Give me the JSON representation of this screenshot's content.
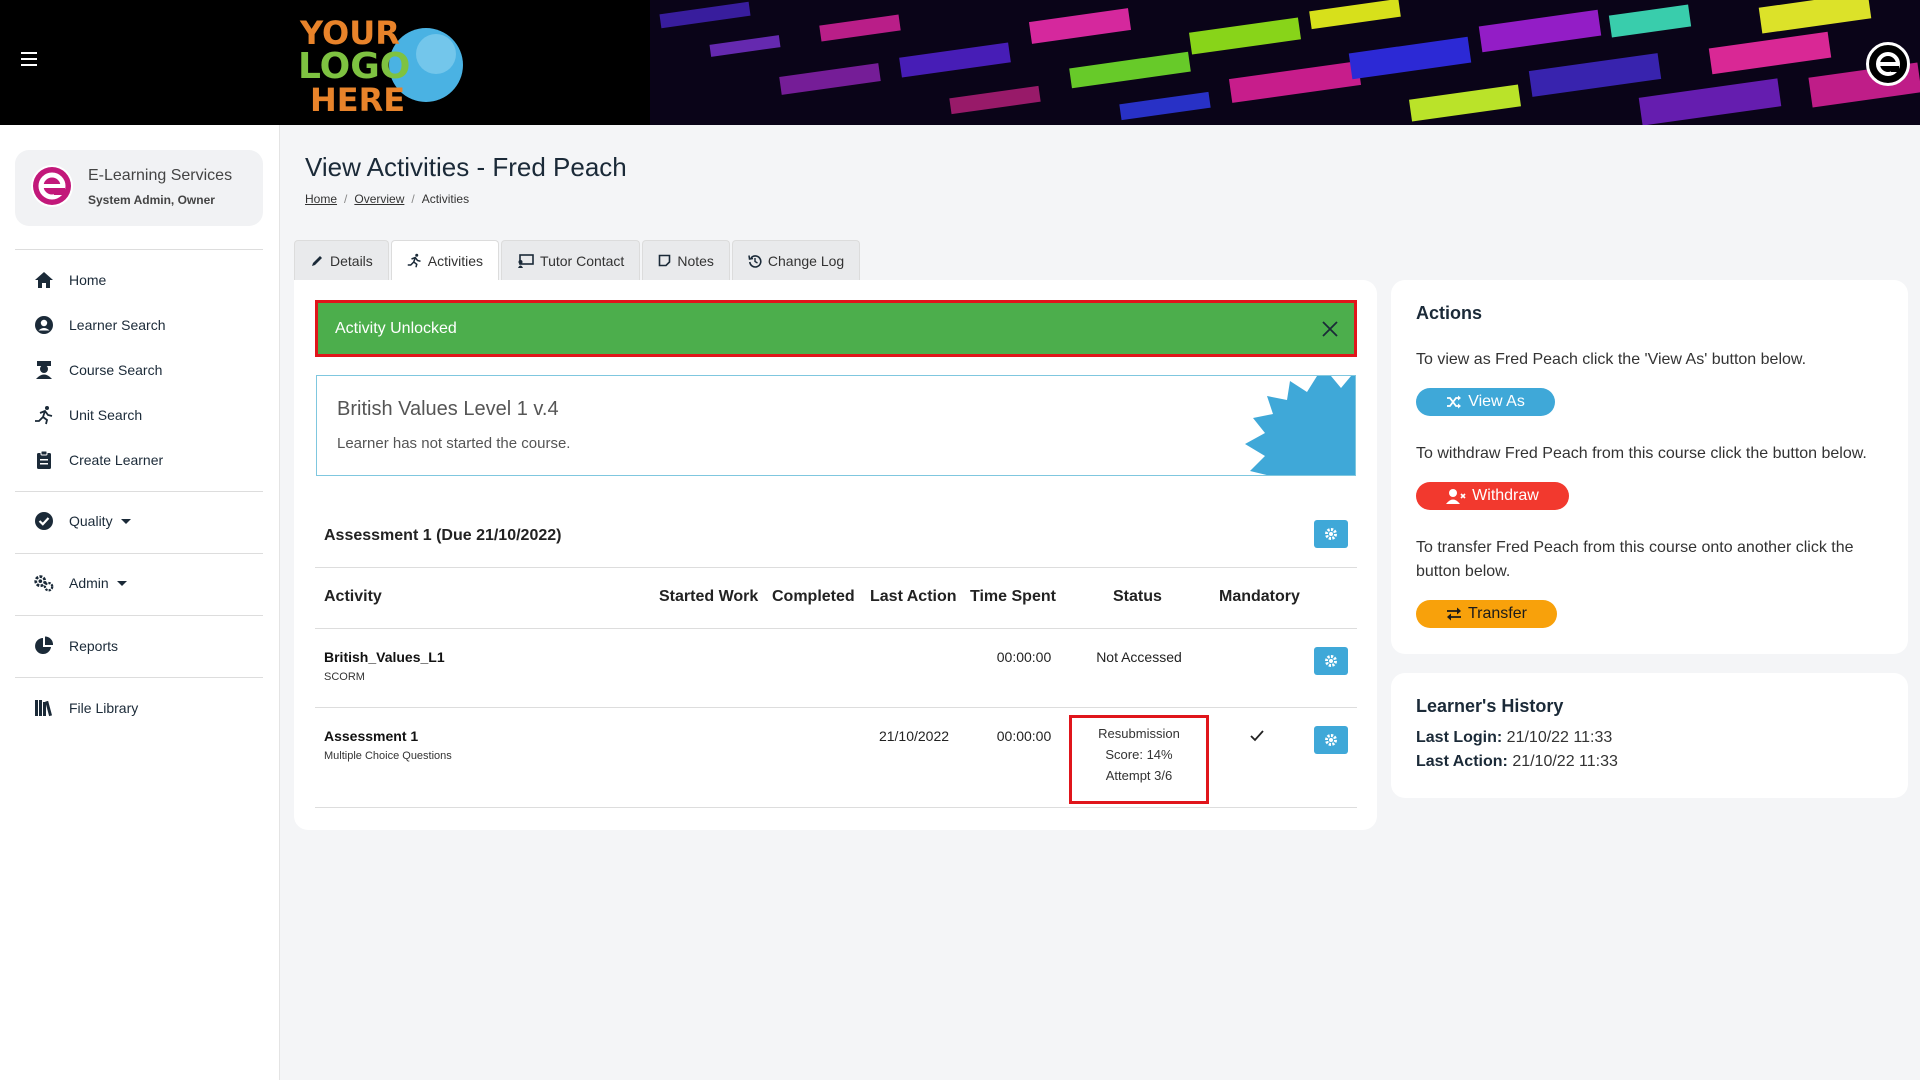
{
  "header": {
    "logo_text": [
      "YOUR",
      "LOGO",
      "HERE"
    ]
  },
  "sidebar": {
    "profile": {
      "name": "E-Learning Services",
      "role": "System Admin, Owner"
    },
    "items": [
      {
        "label": "Home",
        "icon": "home-icon"
      },
      {
        "label": "Learner Search",
        "icon": "user-circle-icon"
      },
      {
        "label": "Course Search",
        "icon": "graduate-icon"
      },
      {
        "label": "Unit Search",
        "icon": "runner-icon"
      },
      {
        "label": "Create Learner",
        "icon": "clipboard-icon"
      },
      {
        "label": "Quality",
        "icon": "check-circle-icon"
      },
      {
        "label": "Admin",
        "icon": "gears-icon"
      },
      {
        "label": "Reports",
        "icon": "pie-chart-icon"
      },
      {
        "label": "File Library",
        "icon": "books-icon"
      }
    ]
  },
  "page": {
    "title": "View Activities - Fred Peach",
    "breadcrumb": [
      "Home",
      "Overview",
      "Activities"
    ]
  },
  "tabs": [
    {
      "label": "Details",
      "icon": "pencil-icon"
    },
    {
      "label": "Activities",
      "icon": "runner-icon"
    },
    {
      "label": "Tutor Contact",
      "icon": "chalkboard-icon"
    },
    {
      "label": "Notes",
      "icon": "note-icon"
    },
    {
      "label": "Change Log",
      "icon": "history-icon"
    }
  ],
  "alert": {
    "text": "Activity Unlocked"
  },
  "course": {
    "title": "British Values Level 1 v.4",
    "status": "Learner has not started the course."
  },
  "assessment": {
    "heading": "Assessment 1 (Due 21/10/2022)",
    "columns": [
      "Activity",
      "Started Work",
      "Completed",
      "Last Action",
      "Time Spent",
      "Status",
      "Mandatory"
    ],
    "rows": [
      {
        "title": "British_Values_L1",
        "subtitle": "SCORM",
        "started": "",
        "completed": "",
        "last_action": "",
        "time_spent": "00:00:00",
        "status": [
          "Not Accessed"
        ],
        "mandatory": false
      },
      {
        "title": "Assessment 1",
        "subtitle": "Multiple Choice Questions",
        "started": "",
        "completed": "",
        "last_action": "21/10/2022",
        "time_spent": "00:00:00",
        "status": [
          "Resubmission",
          "Score: 14%",
          "Attempt 3/6"
        ],
        "mandatory": true
      }
    ]
  },
  "actions": {
    "title": "Actions",
    "view_as_text": "To view as Fred Peach click the 'View As' button below.",
    "view_as_label": "View As",
    "withdraw_text": "To withdraw Fred Peach from this course click the button below.",
    "withdraw_label": "Withdraw",
    "transfer_text": "To transfer Fred Peach from this course onto another click the button below.",
    "transfer_label": "Transfer"
  },
  "history": {
    "title": "Learner's History",
    "last_login_label": "Last Login:",
    "last_login": "21/10/22 11:33",
    "last_action_label": "Last Action:",
    "last_action": "21/10/22 11:33"
  },
  "colors": {
    "header_bg": "#000000",
    "alert_green": "#4cae4c",
    "highlight_red": "#e0151b",
    "accent_blue": "#3fa8d8",
    "withdraw_red": "#f2392e",
    "transfer_orange": "#f8a10b",
    "brand_magenta": "#c2187a"
  }
}
